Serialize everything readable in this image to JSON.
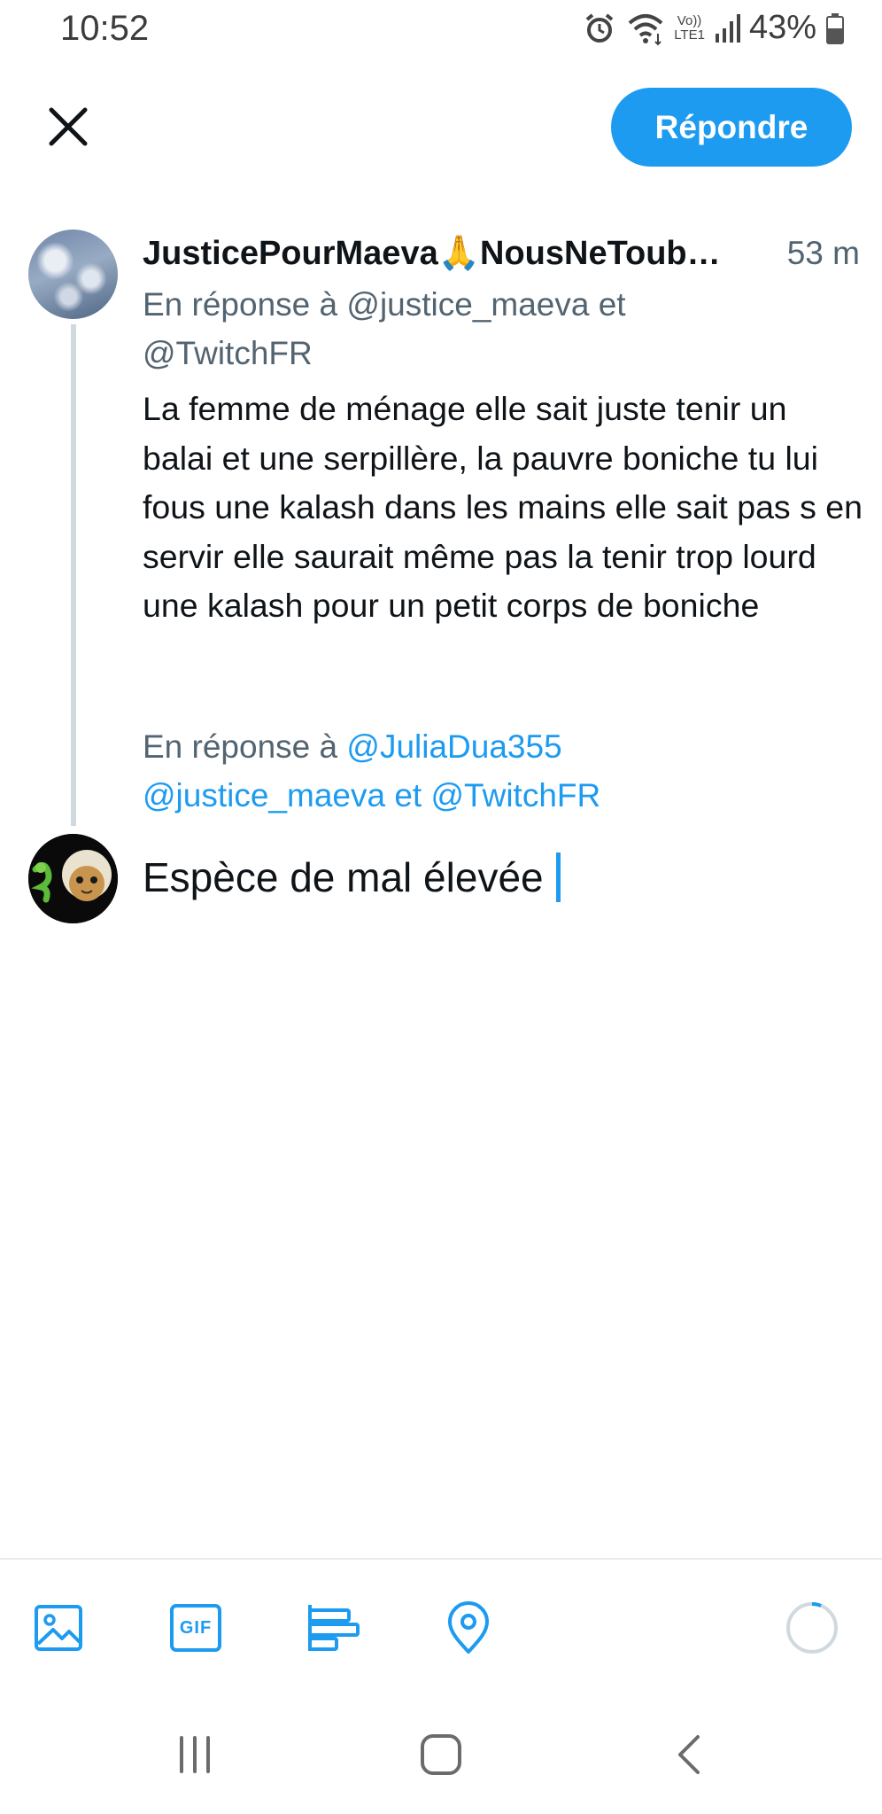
{
  "status_bar": {
    "time": "10:52",
    "network_label_top": "Vo))",
    "network_label_bottom": "LTE1",
    "battery": "43%"
  },
  "header": {
    "close_icon": "close-icon",
    "reply_button_label": "Répondre"
  },
  "original_tweet": {
    "author_name": "JusticePourMaeva🙏NousNeToub…",
    "time": "53 m",
    "reply_context_line1": "En réponse à @justice_maeva et",
    "reply_context_line2": "@TwitchFR",
    "body": "La femme de ménage elle sait juste tenir un balai et une serpillère, la pauvre boniche tu lui fous une kalash dans les mains elle sait pas s en servir elle saurait même pas la tenir trop lourd une kalash pour un petit corps de boniche"
  },
  "compose": {
    "reply_prefix": "En réponse à",
    "mention_1": "@JuliaDua355",
    "mention_2": "@justice_maeva",
    "connector": "et",
    "mention_3": "@TwitchFR",
    "text": "Espèce de mal élevée"
  },
  "toolbar": {
    "items": [
      "image-icon",
      "gif-icon",
      "poll-icon",
      "location-icon"
    ],
    "gif_label": "GIF"
  },
  "colors": {
    "accent": "#1d9bf0",
    "secondary_text": "#536471",
    "primary_text": "#0f1419"
  }
}
